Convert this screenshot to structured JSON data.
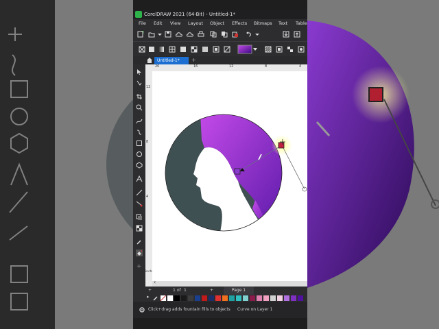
{
  "window": {
    "title": "CorelDRAW 2021 (64-Bit) - Untitled-1*"
  },
  "menu": [
    "File",
    "Edit",
    "View",
    "Layout",
    "Object",
    "Effects",
    "Bitmaps",
    "Text",
    "Table"
  ],
  "document": {
    "tab_label": "Untitled-1*"
  },
  "ruler": {
    "h_ticks": [
      "20",
      "16",
      "12",
      "8",
      "4"
    ],
    "v_ticks": [
      "12",
      "8",
      "4"
    ],
    "units": "inches"
  },
  "pages": {
    "current": "1",
    "of_label": "of",
    "total": "1",
    "page_tab": "Page 1"
  },
  "status": {
    "hint": "Click+drag adds fountain fills to objects",
    "object_info": "Curve on Layer 1"
  },
  "colors": {
    "accent": "#1c6fd1",
    "fill_start": "#c44ae8",
    "fill_end": "#5a1aa8",
    "silhouette": "#3f5053"
  },
  "palette": [
    "#ffffff",
    "#000000",
    "#1a1a1a",
    "#3c3c3c",
    "#1b3f8f",
    "#c01a1a",
    "#1a2f6a",
    "#e03030",
    "#f07020",
    "#20a0a0",
    "#30c0c0",
    "#80d0d0",
    "#8a1a4a",
    "#e080b0",
    "#f0a0c0",
    "#d0d0d0",
    "#f0d0e0",
    "#b070e0",
    "#8030c0",
    "#5010a0"
  ]
}
